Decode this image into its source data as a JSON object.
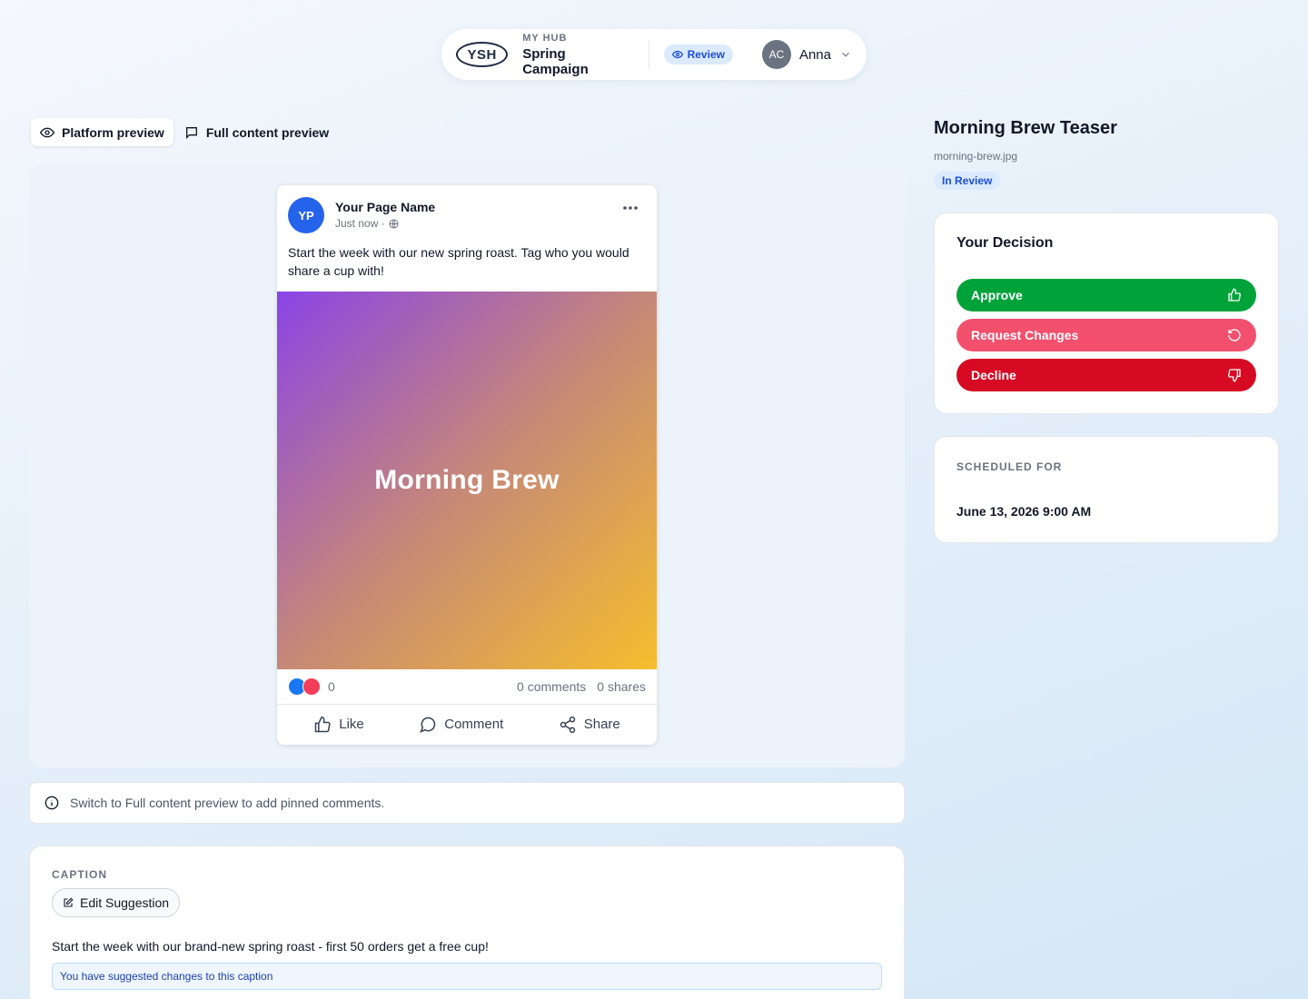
{
  "header": {
    "logo_text": "YSH",
    "hub_label": "MY HUB",
    "campaign": "Spring Campaign",
    "review_label": "Review",
    "user_initials": "AC",
    "user_name": "Anna"
  },
  "preview_tabs": [
    {
      "label": "Platform preview",
      "active": true,
      "icon": "eye-icon"
    },
    {
      "label": "Full content preview",
      "active": false,
      "icon": "comment-icon"
    }
  ],
  "post": {
    "avatar_initials": "YP",
    "page_name": "Your Page Name",
    "time": "Just now ·",
    "text": "Start the week with our new spring roast. Tag who you would share a cup with!",
    "image_text": "Morning Brew",
    "reaction_count": "0",
    "comments": "0 comments",
    "shares": "0 shares",
    "actions": {
      "like": "Like",
      "comment": "Comment",
      "share": "Share"
    }
  },
  "banner": {
    "text": "Switch to Full content preview to add pinned comments."
  },
  "caption": {
    "label": "CAPTION",
    "edit_button": "Edit Suggestion",
    "text": "Start the week with our brand-new spring roast - first 50 orders get a free cup!",
    "note": "You have suggested changes to this caption"
  },
  "asset": {
    "title": "Morning Brew Teaser",
    "file": "morning-brew.jpg",
    "status": "In Review"
  },
  "decision": {
    "title": "Your Decision",
    "approve": "Approve",
    "request_changes": "Request Changes",
    "decline": "Decline"
  },
  "schedule": {
    "label": "SCHEDULED FOR",
    "value": "June 13, 2026 9:00 AM"
  },
  "colors": {
    "approve": "#00a33a",
    "request_changes": "#f2506d",
    "decline": "#d60a22",
    "accent": "#1d4ed8"
  }
}
